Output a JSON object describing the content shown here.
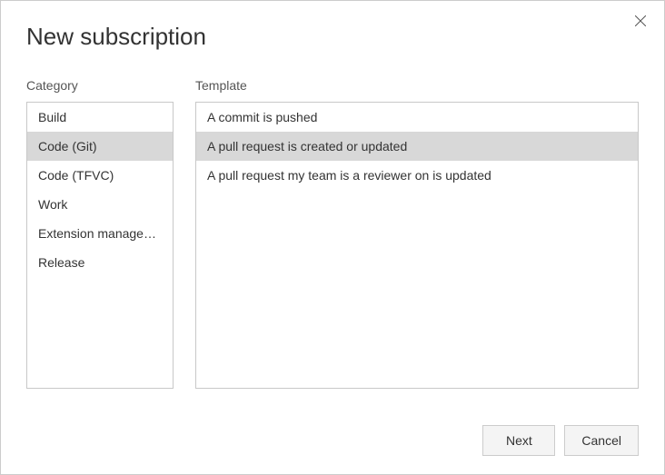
{
  "dialog": {
    "title": "New subscription",
    "category_label": "Category",
    "template_label": "Template"
  },
  "categories": {
    "selected_index": 1,
    "items": [
      {
        "label": "Build"
      },
      {
        "label": "Code (Git)"
      },
      {
        "label": "Code (TFVC)"
      },
      {
        "label": "Work"
      },
      {
        "label": "Extension management"
      },
      {
        "label": "Release"
      }
    ]
  },
  "templates": {
    "selected_index": 1,
    "items": [
      {
        "label": "A commit is pushed"
      },
      {
        "label": "A pull request is created or updated"
      },
      {
        "label": "A pull request my team is a reviewer on is updated"
      }
    ]
  },
  "footer": {
    "next_label": "Next",
    "cancel_label": "Cancel"
  }
}
